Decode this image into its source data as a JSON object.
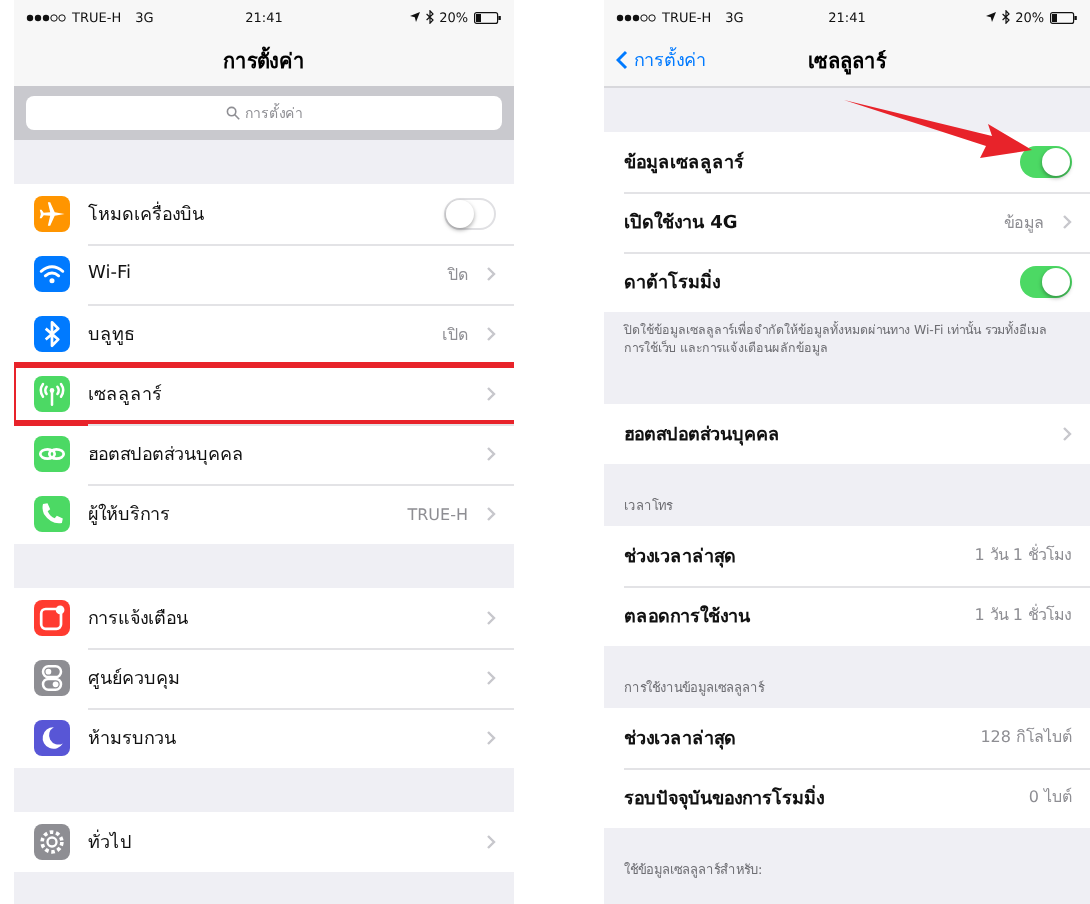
{
  "screens": [
    {
      "status_bar": {
        "carrier": "TRUE-H",
        "network": "3G",
        "time": "21:41",
        "battery": "20%"
      },
      "nav": {
        "title": "การตั้งค่า"
      },
      "search": {
        "placeholder": "การตั้งค่า"
      },
      "groups": [
        {
          "rows": [
            {
              "kind": "toggle",
              "label": "โหมดเครื่องบิน",
              "on": false
            },
            {
              "kind": "link",
              "label": "Wi-Fi",
              "value": "ปิด"
            },
            {
              "kind": "link",
              "label": "บลูทูธ",
              "value": "เปิด"
            },
            {
              "kind": "link",
              "label": "เซลลูลาร์",
              "highlighted": true
            },
            {
              "kind": "link",
              "label": "ฮอตสปอตส่วนบุคคล"
            },
            {
              "kind": "link",
              "label": "ผู้ให้บริการ",
              "value": "TRUE-H"
            }
          ]
        },
        {
          "rows": [
            {
              "kind": "link",
              "label": "การแจ้งเตือน"
            },
            {
              "kind": "link",
              "label": "ศูนย์ควบคุม"
            },
            {
              "kind": "link",
              "label": "ห้ามรบกวน"
            }
          ]
        },
        {
          "rows": [
            {
              "kind": "link",
              "label": "ทั่วไป"
            }
          ]
        }
      ]
    },
    {
      "status_bar": {
        "carrier": "TRUE-H",
        "network": "3G",
        "time": "21:41",
        "battery": "20%"
      },
      "nav": {
        "title": "เซลลูลาร์",
        "back": "การตั้งค่า"
      },
      "groups": [
        {
          "footer": "ปิดใช้ข้อมูลเซลลูลาร์เพื่อจำกัดให้ข้อมูลทั้งหมดผ่านทาง Wi-Fi เท่านั้น รวมทั้งอีเมล การใช้เว็บ และการแจ้งเตือนผลักข้อมูล",
          "rows": [
            {
              "kind": "toggle",
              "label": "ข้อมูลเซลลูลาร์",
              "on": true,
              "pointed": true
            },
            {
              "kind": "link",
              "label": "เปิดใช้งาน 4G",
              "value": "ข้อมูล"
            },
            {
              "kind": "toggle",
              "label": "ดาต้าโรมมิ่ง",
              "on": true
            }
          ]
        },
        {
          "rows": [
            {
              "kind": "link",
              "label": "ฮอตสปอตส่วนบุคคล"
            }
          ]
        },
        {
          "header": "เวลาโทร",
          "rows": [
            {
              "kind": "stat",
              "label": "ช่วงเวลาล่าสุด",
              "value": "1 วัน 1 ชั่วโมง"
            },
            {
              "kind": "stat",
              "label": "ตลอดการใช้งาน",
              "value": "1 วัน 1 ชั่วโมง"
            }
          ]
        },
        {
          "header": "การใช้งานข้อมูลเซลลูลาร์",
          "rows": [
            {
              "kind": "stat",
              "label": "ช่วงเวลาล่าสุด",
              "value": "128 กิโลไบต์"
            },
            {
              "kind": "stat",
              "label": "รอบปัจจุบันของการโรมมิ่ง",
              "value": "0 ไบต์"
            }
          ]
        },
        {
          "header": "ใช้ข้อมูลเซลลูลาร์สำหรับ:"
        }
      ]
    }
  ]
}
